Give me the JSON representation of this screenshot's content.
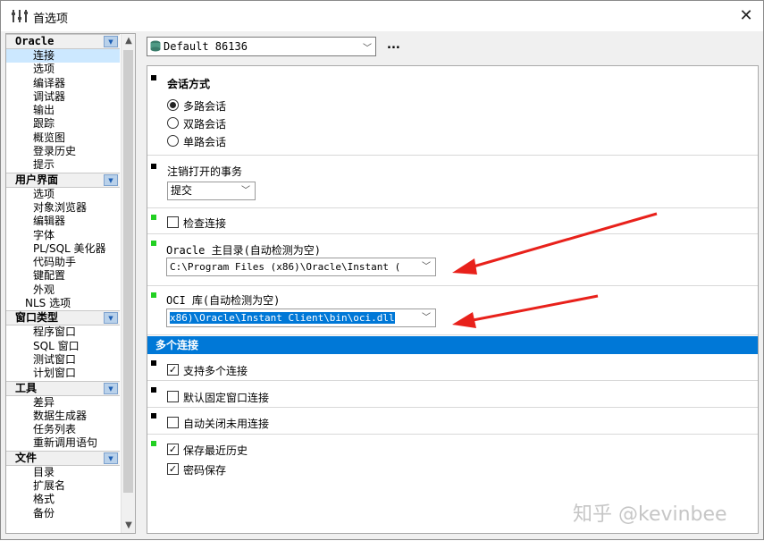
{
  "window": {
    "title": "首选项",
    "close": "✕"
  },
  "tree": {
    "groups": [
      {
        "label": "Oracle",
        "items": [
          "连接",
          "选项",
          "编译器",
          "调试器",
          "输出",
          "跟踪",
          "概览图",
          "登录历史",
          "提示"
        ]
      },
      {
        "label": "用户界面",
        "items": [
          "选项",
          "对象浏览器",
          "编辑器",
          "字体",
          "PL/SQL 美化器",
          "代码助手",
          "键配置",
          "外观",
          "NLS 选项"
        ]
      },
      {
        "label": "窗口类型",
        "items": [
          "程序窗口",
          "SQL 窗口",
          "测试窗口",
          "计划窗口"
        ]
      },
      {
        "label": "工具",
        "items": [
          "差异",
          "数据生成器",
          "任务列表",
          "重新调用语句"
        ]
      },
      {
        "label": "文件",
        "items": [
          "目录",
          "扩展名",
          "格式",
          "备份"
        ]
      }
    ],
    "selected": "连接",
    "scroll_up": "▲",
    "scroll_down": "▼"
  },
  "profile": {
    "value": "Default 86136",
    "more": "..."
  },
  "session_mode": {
    "heading": "会话方式",
    "options": [
      "多路会话",
      "双路会话",
      "单路会话"
    ],
    "selected_index": 0
  },
  "logoff": {
    "label": "注销打开的事务",
    "value": "提交"
  },
  "check_connection": {
    "label": "检查连接",
    "checked": false
  },
  "oracle_home": {
    "label": "Oracle 主目录(自动检测为空)",
    "value": "C:\\Program Files (x86)\\Oracle\\Instant ("
  },
  "oci_library": {
    "label": "OCI 库(自动检测为空)",
    "value": "x86)\\Oracle\\Instant Client\\bin\\oci.dll"
  },
  "multi_connections": {
    "heading": "多个连接",
    "options": [
      {
        "label": "支持多个连接",
        "checked": true
      },
      {
        "label": "默认固定窗口连接",
        "checked": false
      },
      {
        "label": "自动关闭未用连接",
        "checked": false
      },
      {
        "label": "保存最近历史",
        "checked": true
      },
      {
        "label": "密码保存",
        "checked": true
      }
    ]
  },
  "watermark": "知乎 @kevinbee",
  "colors": {
    "accent": "#0078d7",
    "arrow": "#e8211b",
    "marker_green": "#22d022"
  }
}
